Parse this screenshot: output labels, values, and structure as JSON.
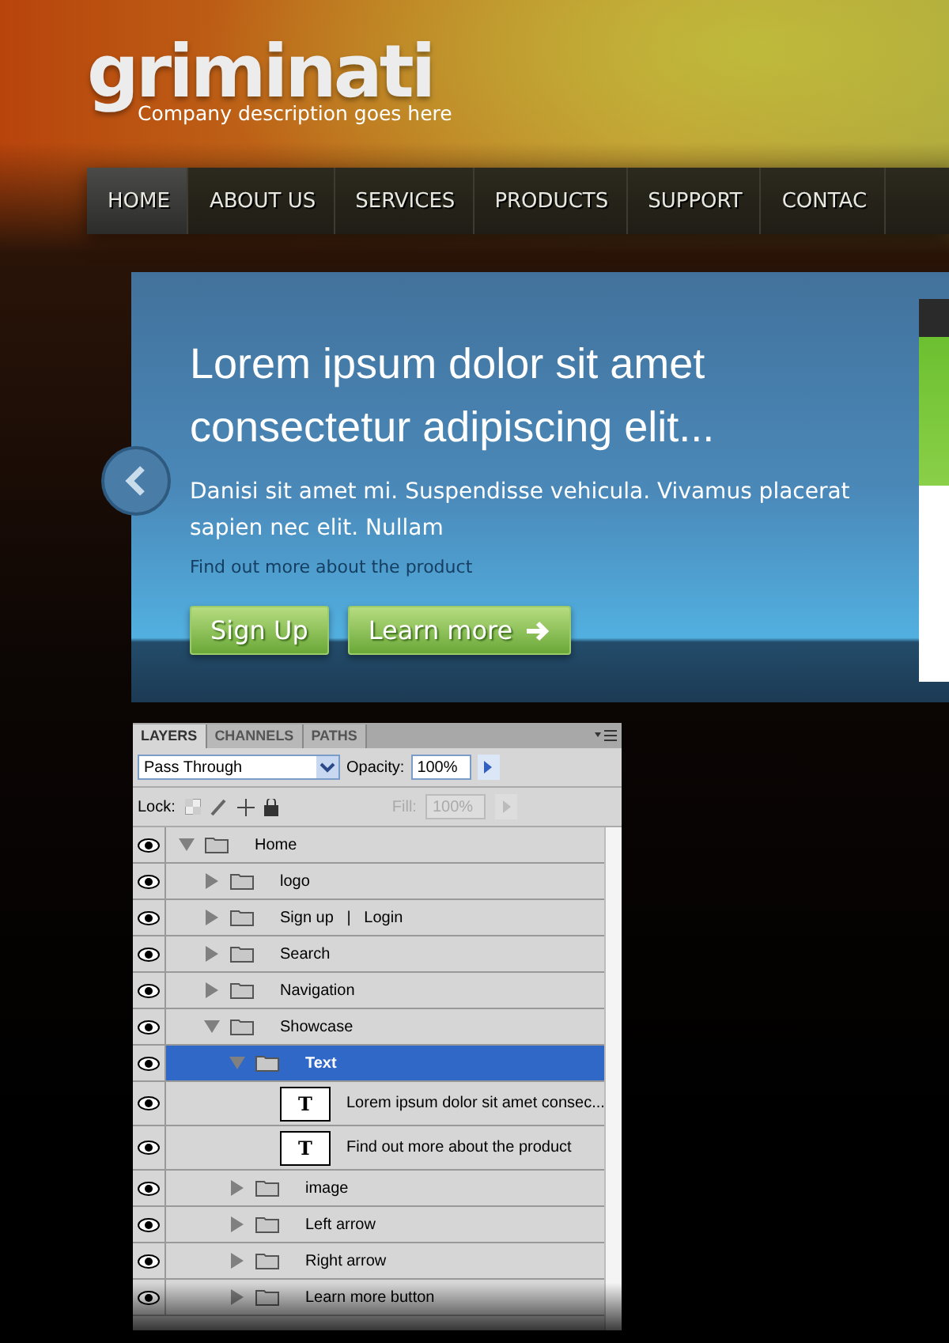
{
  "logo": {
    "name": "griminati",
    "tagline": "Company description goes here"
  },
  "nav": [
    {
      "label": "HOME",
      "selected": true
    },
    {
      "label": "ABOUT US",
      "selected": false
    },
    {
      "label": "SERVICES",
      "selected": false
    },
    {
      "label": "PRODUCTS",
      "selected": false
    },
    {
      "label": "SUPPORT",
      "selected": false
    },
    {
      "label": "CONTAC",
      "selected": false
    }
  ],
  "showcase": {
    "heading": "Lorem ipsum dolor sit amet consectetur adipiscing elit...",
    "body": "Danisi sit amet mi. Suspendisse vehicula. Vivamus placerat sapien nec elit. Nullam",
    "link": "Find out more about the product",
    "buttons": [
      {
        "label": "Sign Up",
        "arrow": false
      },
      {
        "label": "Learn more",
        "arrow": true
      }
    ]
  },
  "layers_panel": {
    "tabs": [
      {
        "label": "LAYERS",
        "selected": true
      },
      {
        "label": "CHANNELS",
        "selected": false
      },
      {
        "label": "PATHS",
        "selected": false
      }
    ],
    "blend_mode": "Pass Through",
    "opacity_label": "Opacity:",
    "opacity": "100%",
    "lock_label": "Lock:",
    "fill_label": "Fill:",
    "fill": "100%",
    "fill_disabled": true,
    "layers": [
      {
        "kind": "folder",
        "name": "Home",
        "expanded": true,
        "selected": false,
        "visible": true,
        "children": [
          {
            "kind": "folder",
            "name": "logo",
            "expanded": false,
            "selected": false,
            "visible": true
          },
          {
            "kind": "folder",
            "name": "Sign up   |   Login",
            "expanded": false,
            "selected": false,
            "visible": true
          },
          {
            "kind": "folder",
            "name": "Search",
            "expanded": false,
            "selected": false,
            "visible": true
          },
          {
            "kind": "folder",
            "name": "Navigation",
            "expanded": false,
            "selected": false,
            "visible": true
          },
          {
            "kind": "folder",
            "name": "Showcase",
            "expanded": true,
            "selected": false,
            "visible": true,
            "children": [
              {
                "kind": "folder",
                "name": "Text",
                "expanded": true,
                "selected": true,
                "visible": true,
                "children": [
                  {
                    "kind": "text",
                    "thumb": "T",
                    "name": "Lorem ipsum dolor sit amet consec...",
                    "selected": false,
                    "visible": true
                  },
                  {
                    "kind": "text",
                    "thumb": "T",
                    "name": "Find out more about the product",
                    "selected": false,
                    "visible": true
                  }
                ]
              },
              {
                "kind": "folder",
                "name": "image",
                "expanded": false,
                "selected": false,
                "visible": true
              },
              {
                "kind": "folder",
                "name": "Left arrow",
                "expanded": false,
                "selected": false,
                "visible": true
              },
              {
                "kind": "folder",
                "name": "Right arrow",
                "expanded": false,
                "selected": false,
                "visible": true
              },
              {
                "kind": "folder",
                "name": "Learn more button",
                "expanded": false,
                "selected": false,
                "visible": true
              }
            ]
          }
        ]
      }
    ]
  }
}
